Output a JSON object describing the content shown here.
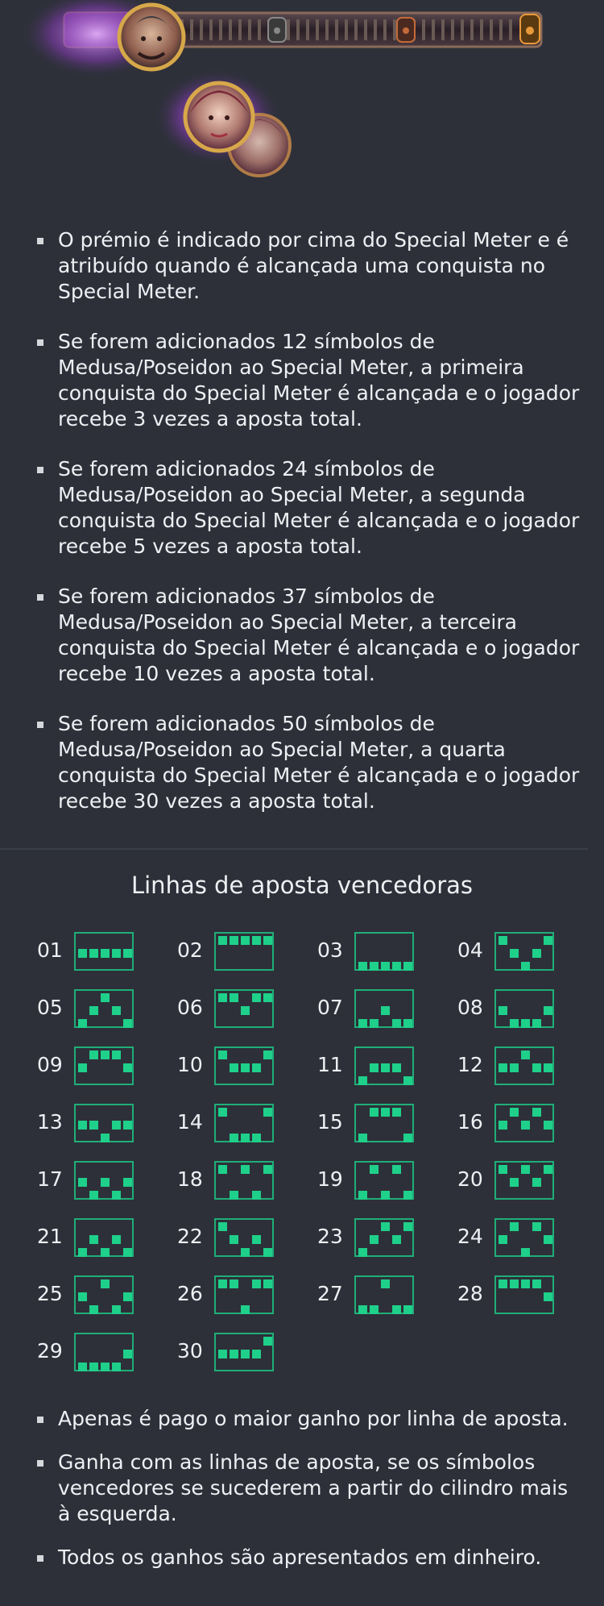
{
  "header": {
    "icons": [
      "warrior-portrait-icon",
      "medusa-portrait-icon",
      "medusa-small-portrait-icon",
      "lock-icon"
    ]
  },
  "meter_rules": [
    "O prémio é indicado por cima do Special Meter e é atribuído quando é alcançada uma conquista no Special Meter.",
    "Se forem adicionados 12 símbolos de Medusa/Poseidon ao Special Meter, a primeira conquista do Special Meter é alcançada e o jogador recebe 3 vezes a aposta total.",
    "Se forem adicionados 24 símbolos de Medusa/Poseidon ao Special Meter, a segunda conquista do Special Meter é alcançada e o jogador recebe 5 vezes a aposta total.",
    "Se forem adicionados 37 símbolos de Medusa/Poseidon ao Special Meter, a terceira conquista do Special Meter é alcançada e o jogador recebe 10 vezes a aposta total.",
    "Se forem adicionados 50 símbolos de Medusa/Poseidon ao Special Meter, a quarta conquista do Special Meter é alcançada e o jogador recebe 30 vezes a aposta total."
  ],
  "paylines_section": {
    "title": "Linhas de aposta vencedoras",
    "lines": [
      {
        "id": "01",
        "rows": [
          1,
          1,
          1,
          1,
          1
        ]
      },
      {
        "id": "02",
        "rows": [
          0,
          0,
          0,
          0,
          0
        ]
      },
      {
        "id": "03",
        "rows": [
          2,
          2,
          2,
          2,
          2
        ]
      },
      {
        "id": "04",
        "rows": [
          0,
          1,
          2,
          1,
          0
        ]
      },
      {
        "id": "05",
        "rows": [
          2,
          1,
          0,
          1,
          2
        ]
      },
      {
        "id": "06",
        "rows": [
          0,
          0,
          1,
          0,
          0
        ]
      },
      {
        "id": "07",
        "rows": [
          2,
          2,
          1,
          2,
          2
        ]
      },
      {
        "id": "08",
        "rows": [
          1,
          2,
          2,
          2,
          1
        ]
      },
      {
        "id": "09",
        "rows": [
          1,
          0,
          0,
          0,
          1
        ]
      },
      {
        "id": "10",
        "rows": [
          0,
          1,
          1,
          1,
          0
        ]
      },
      {
        "id": "11",
        "rows": [
          2,
          1,
          1,
          1,
          2
        ]
      },
      {
        "id": "12",
        "rows": [
          1,
          1,
          0,
          1,
          1
        ]
      },
      {
        "id": "13",
        "rows": [
          1,
          1,
          2,
          1,
          1
        ]
      },
      {
        "id": "14",
        "rows": [
          0,
          2,
          2,
          2,
          0
        ]
      },
      {
        "id": "15",
        "rows": [
          2,
          0,
          0,
          0,
          2
        ]
      },
      {
        "id": "16",
        "rows": [
          1,
          0,
          1,
          0,
          1
        ]
      },
      {
        "id": "17",
        "rows": [
          1,
          2,
          1,
          2,
          1
        ]
      },
      {
        "id": "18",
        "rows": [
          0,
          2,
          0,
          2,
          0
        ]
      },
      {
        "id": "19",
        "rows": [
          2,
          0,
          2,
          0,
          2
        ]
      },
      {
        "id": "20",
        "rows": [
          0,
          1,
          0,
          1,
          0
        ]
      },
      {
        "id": "21",
        "rows": [
          2,
          1,
          2,
          1,
          2
        ]
      },
      {
        "id": "22",
        "rows": [
          0,
          1,
          2,
          1,
          2
        ]
      },
      {
        "id": "23",
        "rows": [
          2,
          1,
          0,
          1,
          0
        ]
      },
      {
        "id": "24",
        "rows": [
          1,
          0,
          2,
          0,
          1
        ]
      },
      {
        "id": "25",
        "rows": [
          1,
          2,
          0,
          2,
          1
        ]
      },
      {
        "id": "26",
        "rows": [
          0,
          0,
          2,
          0,
          0
        ]
      },
      {
        "id": "27",
        "rows": [
          2,
          2,
          0,
          2,
          2
        ]
      },
      {
        "id": "28",
        "rows": [
          0,
          0,
          0,
          0,
          1
        ]
      },
      {
        "id": "29",
        "rows": [
          2,
          2,
          2,
          2,
          1
        ]
      },
      {
        "id": "30",
        "rows": [
          1,
          1,
          1,
          1,
          0
        ]
      }
    ]
  },
  "general_rules": [
    "Apenas é pago o maior ganho por linha de aposta.",
    "Ganha com as linhas de aposta, se os símbolos vencedores se sucederem a partir do cilindro mais à esquerda.",
    "Todos os ganhos são apresentados em dinheiro."
  ],
  "colors": {
    "background": "#2d3039",
    "text": "#eef0f3",
    "payline_border": "#1fae78",
    "payline_cell": "#1fd08a",
    "meter_glow": "#b14be0"
  }
}
